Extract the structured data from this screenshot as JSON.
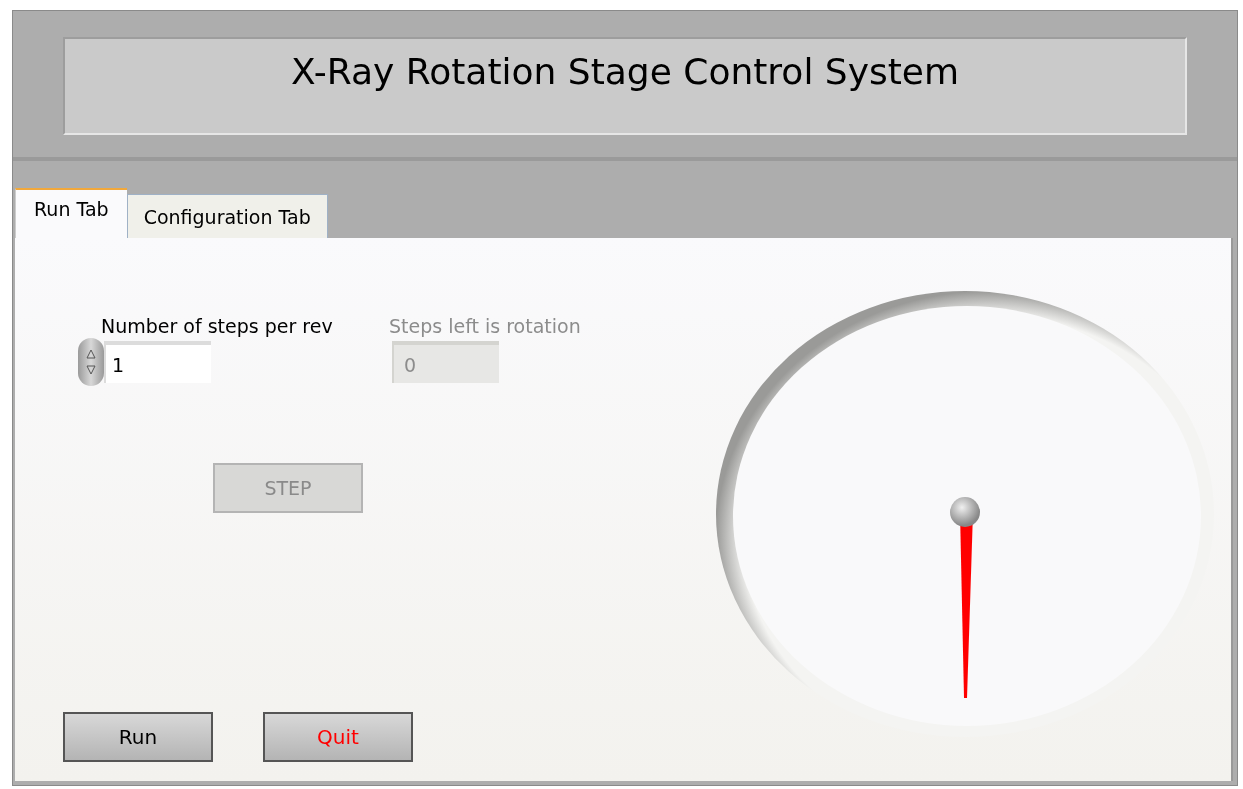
{
  "window": {
    "title": "X-Ray Rotation Stage Control System"
  },
  "tabs": [
    {
      "label": "Run Tab",
      "selected": true
    },
    {
      "label": "Configuration Tab",
      "selected": false
    }
  ],
  "controls": [
    {
      "kind": "numeric",
      "label": "Number of steps per rev",
      "value": "1",
      "disabled": false
    },
    {
      "kind": "indicator",
      "label": "Steps left is rotation",
      "value": "0",
      "disabled": true
    }
  ],
  "step_button": {
    "label": "STEP",
    "disabled": true
  },
  "buttons": [
    {
      "label": "Run",
      "color": "#000000"
    },
    {
      "label": "Quit",
      "color": "#ff0000"
    }
  ]
}
